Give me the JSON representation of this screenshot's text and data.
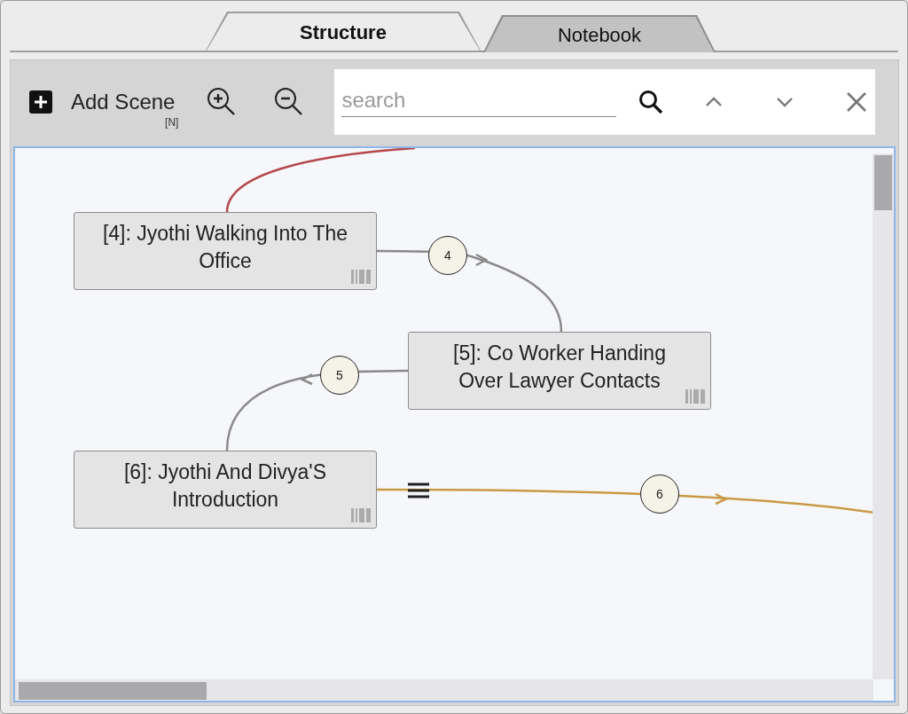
{
  "tabs": [
    {
      "label": "Structure",
      "selected": true
    },
    {
      "label": "Notebook",
      "selected": false
    }
  ],
  "toolbar": {
    "add_scene": {
      "label": "Add Scene",
      "shortcut": "[N]"
    },
    "search": {
      "placeholder": "search"
    }
  },
  "nodes": [
    {
      "label": "[4]: Jyothi Walking Into The Office"
    },
    {
      "label": "[5]: Co Worker Handing Over Lawyer Contacts"
    },
    {
      "label": "[6]: Jyothi And Divya'S Introduction"
    }
  ],
  "edges": [
    {
      "color": "#b5484b"
    },
    {
      "label": "4",
      "color": "#8a8a8a"
    },
    {
      "label": "5",
      "color": "#8a8a8a"
    },
    {
      "label": "6",
      "color": "#c99a45"
    }
  ]
}
